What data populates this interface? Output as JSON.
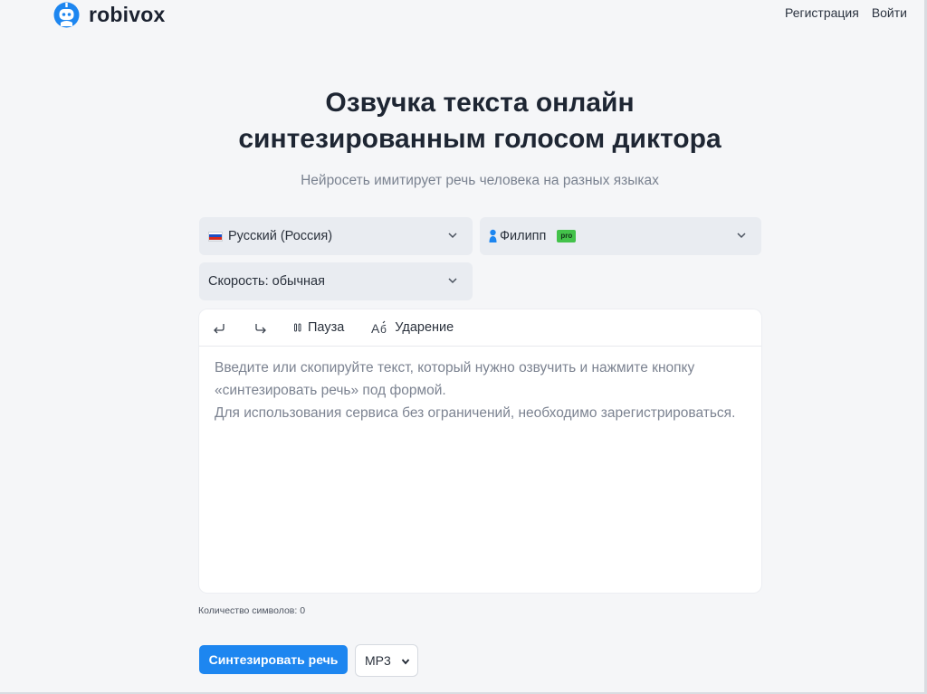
{
  "header": {
    "brand": "robivox",
    "nav": {
      "register": "Регистрация",
      "login": "Войти"
    }
  },
  "hero": {
    "title_line1": "Озвучка текста онлайн",
    "title_line2": "синтезированным голосом диктора",
    "subtitle": "Нейросеть имитирует речь человека на разных языках"
  },
  "selects": {
    "language": {
      "value": "Русский (Россия)",
      "icon": "russia-flag-icon"
    },
    "voice": {
      "value": "Филипп",
      "badge": "pro",
      "icon": "person-icon"
    },
    "speed": {
      "value": "Скорость: обычная"
    }
  },
  "toolbar": {
    "undo_icon": "undo-icon",
    "redo_icon": "redo-icon",
    "pause_label": "Пауза",
    "stress_label": "Ударение"
  },
  "editor": {
    "placeholder": "Введите или скопируйте текст, который нужно озвучить и нажмите кнопку «синтезировать речь» под формой.\nДля использования сервиса без ограничений, необходимо зарегистрироваться."
  },
  "counter": {
    "text": "Количество символов: 0"
  },
  "actions": {
    "synthesize_label": "Синтезировать речь",
    "format_value": "MP3"
  },
  "colors": {
    "accent": "#1d86f0",
    "pro_badge": "#43c24a",
    "page_bg": "#f5f6f8",
    "select_bg": "#e9ecf1"
  }
}
